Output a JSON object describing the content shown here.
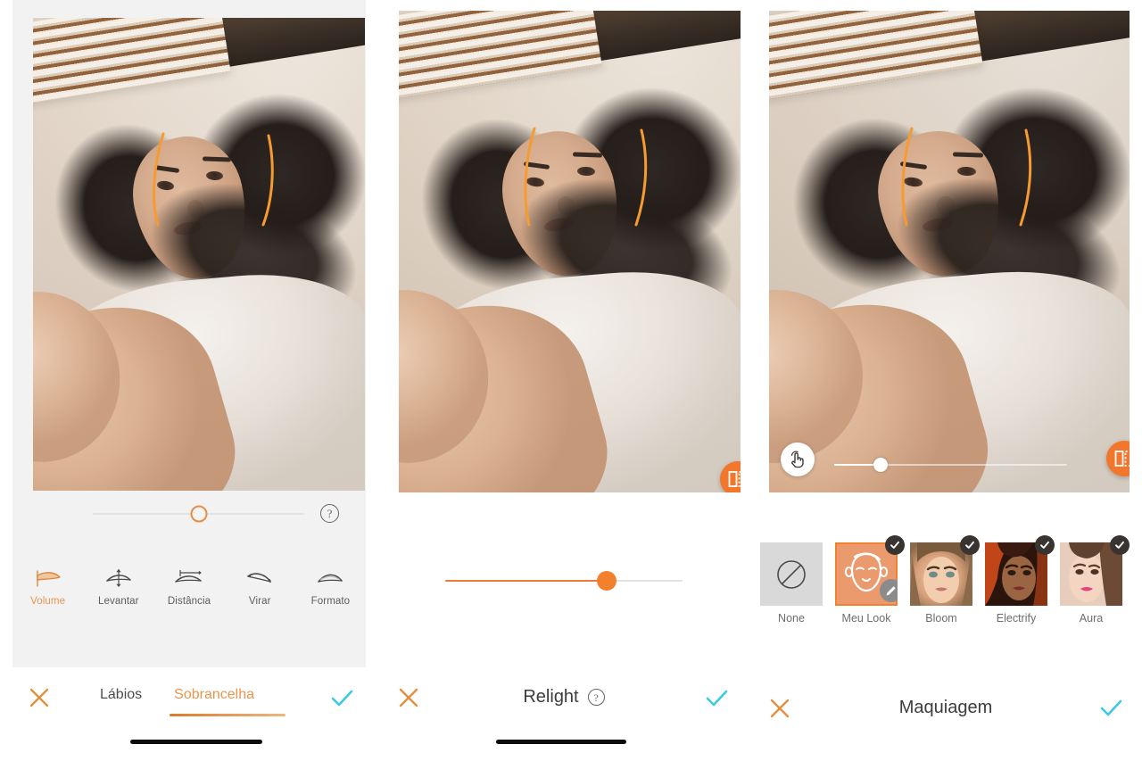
{
  "app": {
    "accent_orange": "#ee7a35",
    "accent_orange_text": "#e8954e",
    "confirm_cyan": "#3fc8e4",
    "cancel_orange": "#e0913f",
    "panel_bg_gray": "#f2f2f2"
  },
  "panel1": {
    "name": "eyebrow-editor",
    "slider": {
      "name": "intensity-slider",
      "value": 50,
      "min": 0,
      "max": 100
    },
    "help_icon": "question-mark-icon",
    "tools": [
      {
        "label": "Volume",
        "icon": "brow-volume-icon",
        "active": true
      },
      {
        "label": "Levantar",
        "icon": "brow-raise-icon",
        "active": false
      },
      {
        "label": "Distância",
        "icon": "brow-distance-icon",
        "active": false
      },
      {
        "label": "Virar",
        "icon": "brow-flip-icon",
        "active": false
      },
      {
        "label": "Formato",
        "icon": "brow-shape-icon",
        "active": false
      }
    ],
    "bottom_bar": {
      "cancel_icon": "close-x-icon",
      "confirm_icon": "check-icon",
      "tabs": [
        {
          "label": "Lábios",
          "active": false
        },
        {
          "label": "Sobrancelha",
          "active": true
        }
      ]
    }
  },
  "panel2": {
    "name": "relight-editor",
    "compare_button_icon": "compare-split-icon",
    "slider": {
      "name": "relight-intensity-slider",
      "value": 68,
      "min": 0,
      "max": 100
    },
    "bottom_bar": {
      "cancel_icon": "close-x-icon",
      "confirm_icon": "check-icon",
      "title": "Relight",
      "help_icon": "question-mark-icon"
    }
  },
  "panel3": {
    "name": "makeup-editor",
    "touch_button_icon": "tap-gesture-icon",
    "compare_button_icon": "compare-split-icon",
    "overlay_slider": {
      "name": "makeup-opacity-slider",
      "value": 20,
      "min": 0,
      "max": 100
    },
    "looks": [
      {
        "label": "None",
        "icon": "no-entry-icon",
        "selected": false,
        "checked": false,
        "editable": false
      },
      {
        "label": "Meu Look",
        "icon": "face-outline-icon",
        "selected": true,
        "checked": true,
        "editable": true
      },
      {
        "label": "Bloom",
        "icon": "model-photo",
        "selected": false,
        "checked": true,
        "editable": false
      },
      {
        "label": "Electrify",
        "icon": "model-photo",
        "selected": false,
        "checked": true,
        "editable": false
      },
      {
        "label": "Aura",
        "icon": "model-photo",
        "selected": false,
        "checked": true,
        "editable": false
      }
    ],
    "bottom_bar": {
      "cancel_icon": "close-x-icon",
      "confirm_icon": "check-icon",
      "title": "Maquiagem"
    }
  }
}
